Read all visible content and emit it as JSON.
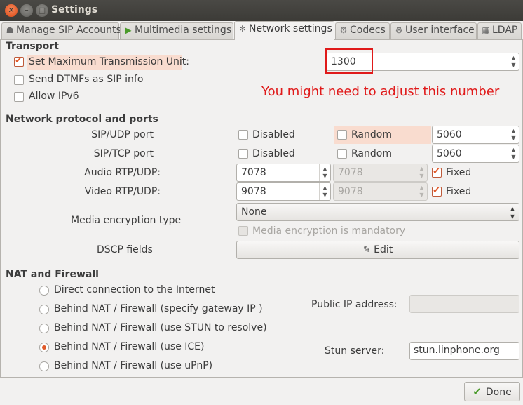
{
  "window": {
    "title": "Settings"
  },
  "tabs": [
    {
      "label": "Manage SIP Accounts",
      "icon": "accounts-icon"
    },
    {
      "label": "Multimedia settings",
      "icon": "play-icon"
    },
    {
      "label": "Network settings",
      "icon": "network-icon",
      "active": true
    },
    {
      "label": "Codecs",
      "icon": "codecs-icon"
    },
    {
      "label": "User interface",
      "icon": "gear-icon"
    },
    {
      "label": "LDAP",
      "icon": "ldap-icon"
    }
  ],
  "transport": {
    "heading": "Transport",
    "mtu_label": "Set Maximum Transmission Unit:",
    "mtu_checked": true,
    "mtu_value": "1300",
    "dtmf_label": "Send DTMFs as SIP info",
    "dtmf_checked": false,
    "ipv6_label": "Allow IPv6",
    "ipv6_checked": false,
    "annotation": "You might need to adjust this number"
  },
  "network": {
    "heading": "Network protocol and ports",
    "sip_udp": {
      "label": "SIP/UDP port",
      "disabled_label": "Disabled",
      "random_label": "Random",
      "port": "5060"
    },
    "sip_tcp": {
      "label": "SIP/TCP port",
      "disabled_label": "Disabled",
      "random_label": "Random",
      "port": "5060"
    },
    "audio_rtp": {
      "label": "Audio RTP/UDP:",
      "min": "7078",
      "max": "7078",
      "fixed_label": "Fixed",
      "fixed_checked": true
    },
    "video_rtp": {
      "label": "Video RTP/UDP:",
      "min": "9078",
      "max": "9078",
      "fixed_label": "Fixed",
      "fixed_checked": true
    },
    "encryption": {
      "label": "Media encryption type",
      "value": "None",
      "mandatory_label": "Media encryption is mandatory"
    },
    "dscp": {
      "label": "DSCP fields",
      "button_label": "Edit"
    }
  },
  "nat": {
    "heading": "NAT and Firewall",
    "options": [
      {
        "label": "Direct connection to the Internet",
        "selected": false
      },
      {
        "label": "Behind NAT / Firewall (specify gateway IP )",
        "selected": false
      },
      {
        "label": "Behind NAT / Firewall (use STUN to resolve)",
        "selected": false
      },
      {
        "label": "Behind NAT / Firewall (use ICE)",
        "selected": true
      },
      {
        "label": "Behind NAT / Firewall (use uPnP)",
        "selected": false
      }
    ],
    "public_ip_label": "Public IP address:",
    "public_ip_value": "",
    "stun_label": "Stun server:",
    "stun_value": "stun.linphone.org"
  },
  "footer": {
    "done_label": "Done"
  },
  "colors": {
    "accent": "#e05a2a",
    "annotation": "#e01a1a",
    "titlebar": "#3c3b37"
  }
}
